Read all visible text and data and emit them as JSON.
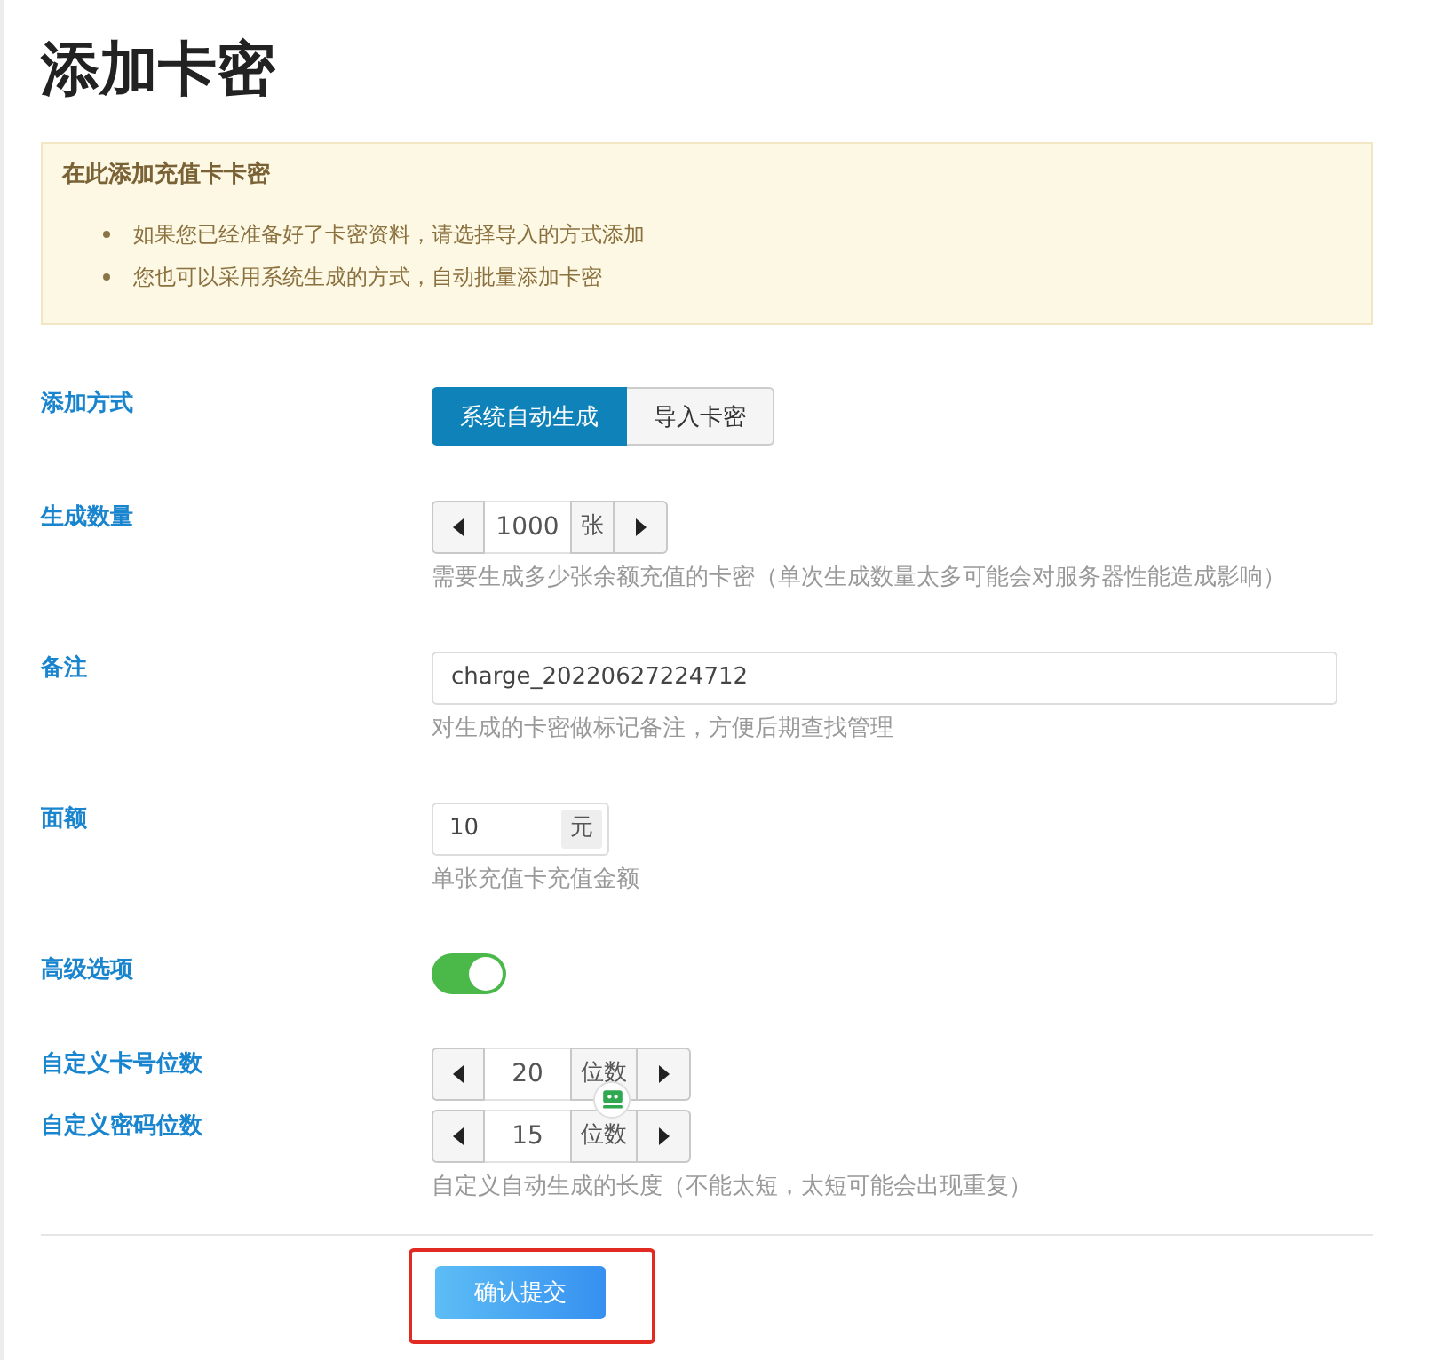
{
  "page": {
    "title": "添加卡密"
  },
  "notice": {
    "title": "在此添加充值卡卡密",
    "items": [
      "如果您已经准备好了卡密资料，请选择导入的方式添加",
      "您也可以采用系统生成的方式，自动批量添加卡密"
    ]
  },
  "form": {
    "fields": [
      {
        "kind": "segmented",
        "label": "添加方式",
        "options": [
          {
            "label": "系统自动生成",
            "selected": true
          },
          {
            "label": "导入卡密",
            "selected": false
          }
        ]
      },
      {
        "kind": "stepper",
        "label": "生成数量",
        "value": "1000",
        "unit": "张",
        "help": "需要生成多少张余额充值的卡密（单次生成数量太多可能会对服务器性能造成影响）"
      },
      {
        "kind": "text",
        "label": "备注",
        "value": "charge_20220627224712",
        "help": "对生成的卡密做标记备注，方便后期查找管理"
      },
      {
        "kind": "addon",
        "label": "面额",
        "value": "10",
        "unit": "元",
        "help": "单张充值卡充值金额"
      },
      {
        "kind": "toggle",
        "label": "高级选项",
        "on": true
      },
      {
        "kind": "stepper",
        "label": "自定义卡号位数",
        "value": "20",
        "unit": "位数"
      },
      {
        "kind": "stepper",
        "label": "自定义密码位数",
        "value": "15",
        "unit": "位数",
        "help": "自定义自动生成的长度（不能太短，太短可能会出现重复）"
      }
    ]
  },
  "submit": {
    "label": "确认提交",
    "highlighted": true
  }
}
